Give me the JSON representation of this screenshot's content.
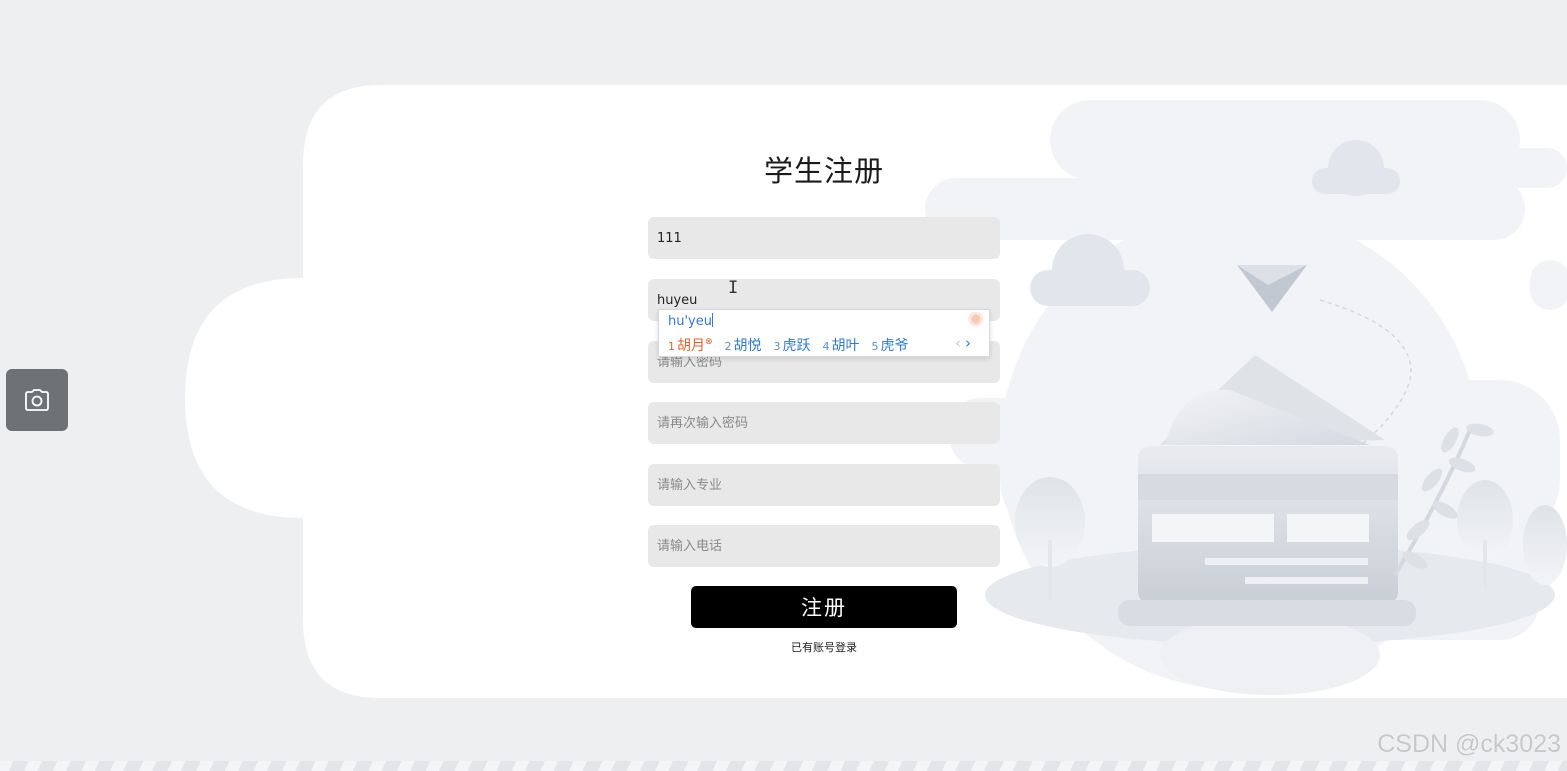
{
  "page": {
    "title": "学生注册"
  },
  "form": {
    "field1": {
      "value": "111",
      "placeholder": ""
    },
    "field2": {
      "value": "huyeu",
      "placeholder": ""
    },
    "password": {
      "value": "",
      "placeholder": "请输入密码"
    },
    "confirm_password": {
      "value": "",
      "placeholder": "请再次输入密码"
    },
    "major": {
      "value": "",
      "placeholder": "请输入专业"
    },
    "phone": {
      "value": "",
      "placeholder": "请输入电话"
    },
    "submit_label": "注册",
    "login_link": "已有账号登录"
  },
  "ime": {
    "pinyin": "hu'yeu",
    "candidates": [
      {
        "num": "1",
        "text": "胡月"
      },
      {
        "num": "2",
        "text": "胡悦"
      },
      {
        "num": "3",
        "text": "虎跃"
      },
      {
        "num": "4",
        "text": "胡叶"
      },
      {
        "num": "5",
        "text": "虎爷"
      }
    ],
    "prev_arrow": "‹",
    "next_arrow": "›",
    "selected_flag": "⊗"
  },
  "sidebar": {
    "camera_icon": "camera-icon"
  },
  "watermark": "CSDN @ck3023",
  "colors": {
    "background": "#eeeff1",
    "card": "#ffffff",
    "input_bg": "#e8e8e8",
    "button": "#000000",
    "ime_text": "#2e7bcf",
    "ime_selected": "#e0632a",
    "camera_button": "#6f7275"
  }
}
